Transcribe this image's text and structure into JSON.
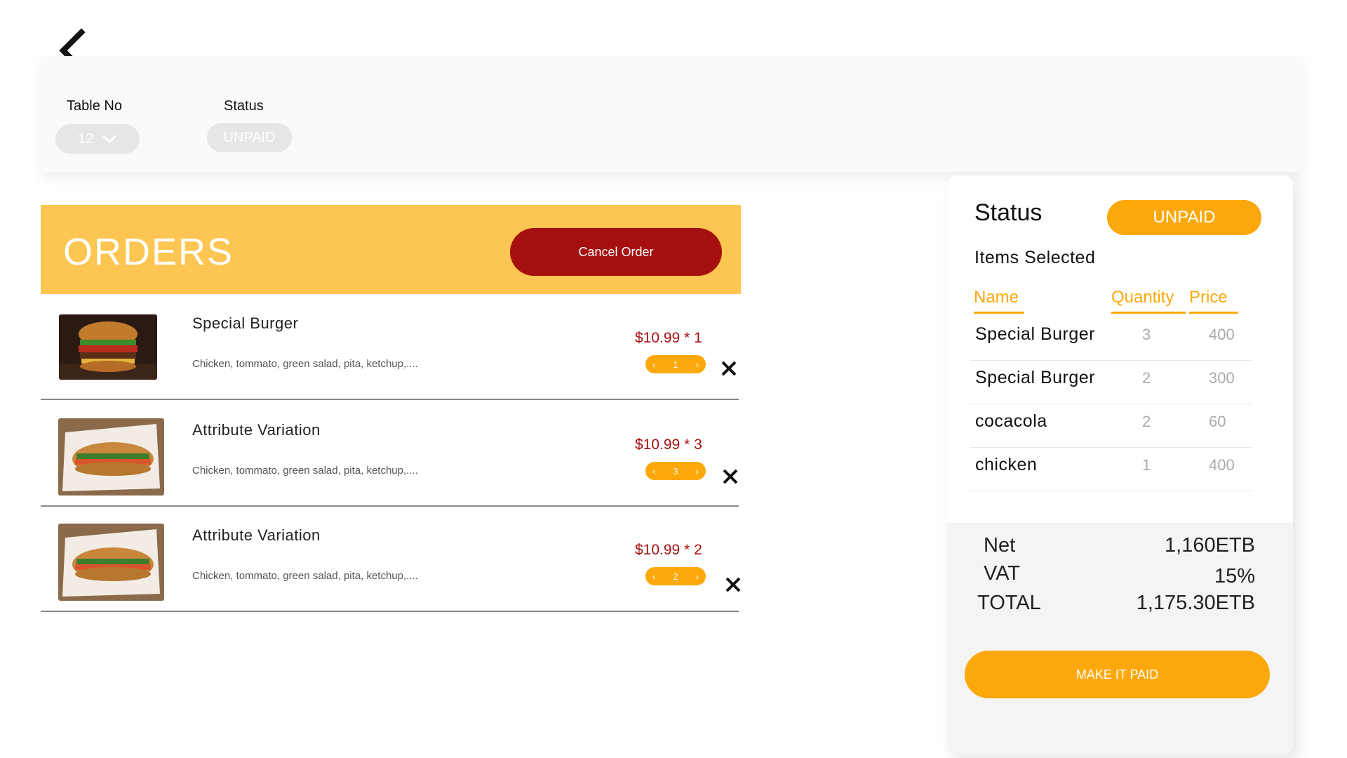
{
  "filters": {
    "table_label": "Table No",
    "table_value": "12",
    "status_label": "Status",
    "status_value": "UNPAID"
  },
  "orders": {
    "title": "ORDERS",
    "cancel_label": "Cancel Order",
    "items": [
      {
        "name": "Special Burger",
        "description": "Chicken, tommato, green salad, pita, ketchup,....",
        "price_text": "$10.99 * 1",
        "quantity": "1",
        "image": "burger-image"
      },
      {
        "name": "Attribute Variation",
        "description": "Chicken, tommato, green salad, pita, ketchup,....",
        "price_text": "$10.99 * 3",
        "quantity": "3",
        "image": "sandwich-image"
      },
      {
        "name": "Attribute Variation",
        "description": "Chicken, tommato, green salad, pita, ketchup,....",
        "price_text": "$10.99 * 2",
        "quantity": "2",
        "image": "sandwich-image"
      }
    ]
  },
  "summary": {
    "status_label": "Status",
    "status_value": "UNPAID",
    "items_selected_label": "Items Selected",
    "columns": {
      "name": "Name",
      "quantity": "Quantity",
      "price": "Price"
    },
    "rows": [
      {
        "name": "Special Burger",
        "quantity": "3",
        "price": "400"
      },
      {
        "name": "Special Burger",
        "quantity": "2",
        "price": "300"
      },
      {
        "name": "cocacola",
        "quantity": "2",
        "price": "60"
      },
      {
        "name": "chicken",
        "quantity": "1",
        "price": "400"
      }
    ],
    "net_label": "Net",
    "net_value": "1,160ETB",
    "vat_label": "VAT",
    "vat_value": "15%",
    "total_label": "TOTAL",
    "total_value": "1,175.30ETB",
    "pay_button": "MAKE IT PAID"
  },
  "colors": {
    "accent": "#fda80a",
    "header_bg": "#fdc551",
    "cancel": "#a50f10",
    "price": "#a50f10"
  },
  "icons": [
    "back-chevron-icon",
    "chevron-down-icon",
    "chevron-left-icon",
    "chevron-right-icon",
    "close-icon"
  ]
}
